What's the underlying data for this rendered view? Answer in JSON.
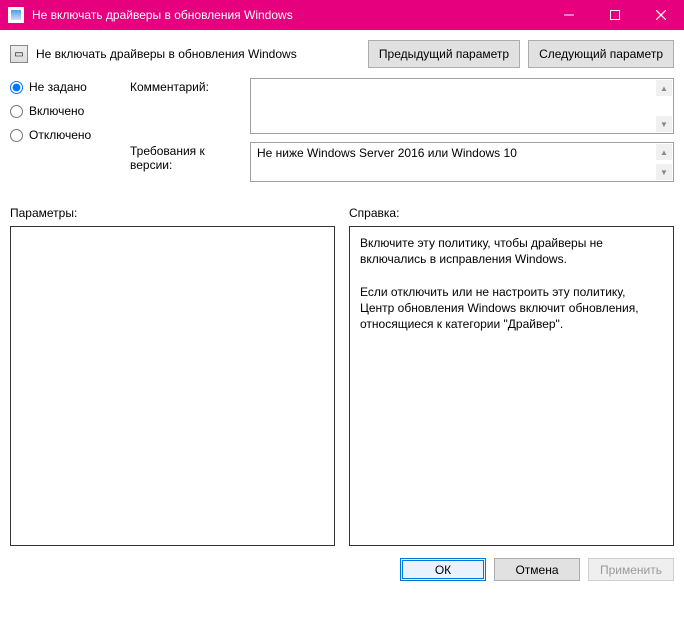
{
  "window": {
    "title": "Не включать драйверы в обновления Windows"
  },
  "policy": {
    "title": "Не включать драйверы в обновления Windows"
  },
  "nav": {
    "prev": "Предыдущий параметр",
    "next": "Следующий параметр"
  },
  "state": {
    "not_configured": "Не задано",
    "enabled": "Включено",
    "disabled": "Отключено",
    "selected": "not_configured"
  },
  "labels": {
    "comment": "Комментарий:",
    "supported": "Требования к версии:",
    "options": "Параметры:",
    "help": "Справка:"
  },
  "fields": {
    "comment": "",
    "supported": "Не ниже Windows Server 2016 или Windows 10"
  },
  "help_text": "Включите эту политику, чтобы драйверы не включались в исправления Windows.\n\nЕсли отключить или не настроить эту политику, Центр обновления Windows включит обновления, относящиеся к категории \"Драйвер\".",
  "footer": {
    "ok": "ОК",
    "cancel": "Отмена",
    "apply": "Применить"
  }
}
